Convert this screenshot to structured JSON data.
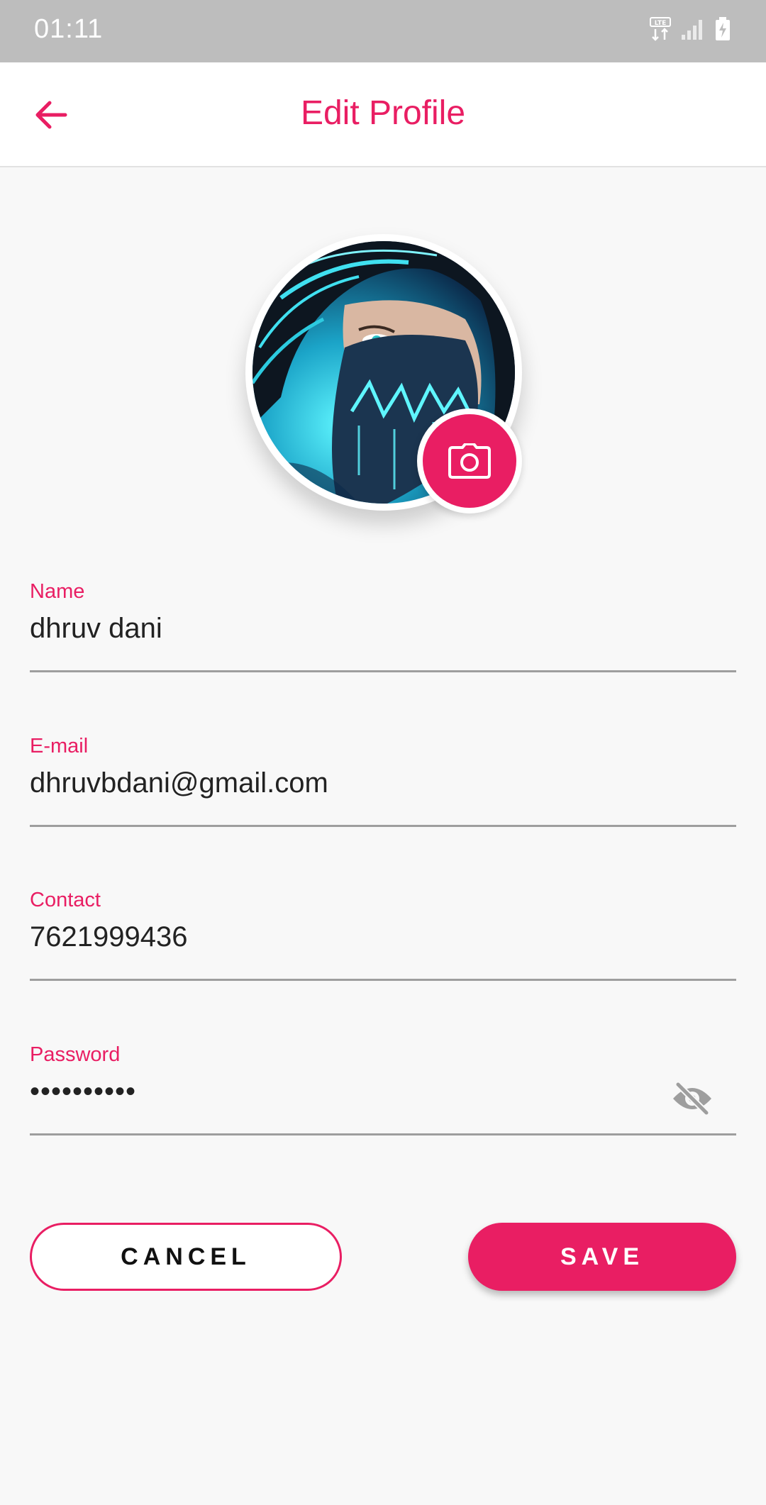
{
  "status_bar": {
    "time": "01:11",
    "network_label": "LTE"
  },
  "app_bar": {
    "title": "Edit Profile",
    "back_icon": "arrow-back-icon"
  },
  "profile": {
    "avatar_alt": "profile picture",
    "camera_icon": "camera-icon"
  },
  "fields": {
    "name": {
      "label": "Name",
      "value": "dhruv dani"
    },
    "email": {
      "label": "E-mail",
      "value": "dhruvbdani@gmail.com"
    },
    "contact": {
      "label": "Contact",
      "value": "7621999436"
    },
    "password": {
      "label": "Password",
      "value": "••••••••••",
      "toggle_icon": "eye-off-icon"
    }
  },
  "buttons": {
    "cancel": "CANCEL",
    "save": "SAVE"
  },
  "colors": {
    "accent": "#e91e63",
    "status_bar": "#bdbdbd",
    "background": "#f8f8f8"
  }
}
